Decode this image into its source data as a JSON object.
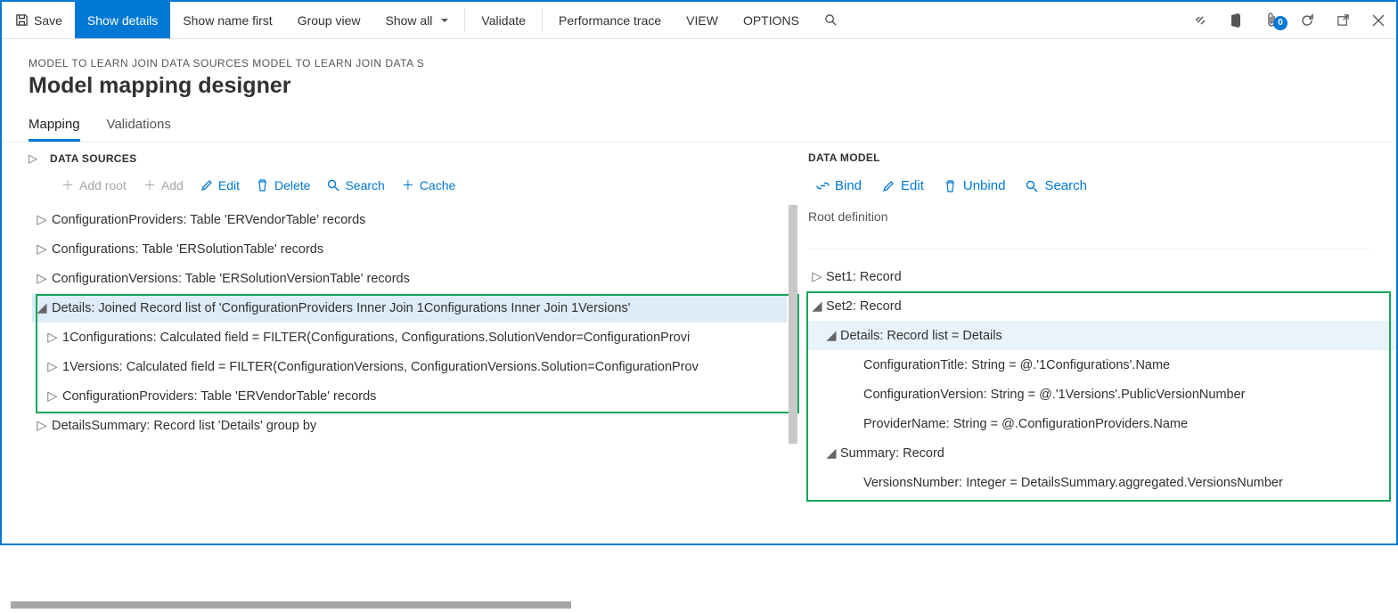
{
  "toolbar": {
    "save": "Save",
    "show_details": "Show details",
    "show_name_first": "Show name first",
    "group_view": "Group view",
    "show_all": "Show all",
    "validate": "Validate",
    "performance_trace": "Performance trace",
    "view": "VIEW",
    "options": "OPTIONS",
    "badge_count": "0"
  },
  "header": {
    "breadcrumb": "MODEL TO LEARN JOIN DATA SOURCES MODEL TO LEARN JOIN DATA S",
    "title": "Model mapping designer"
  },
  "tabs": {
    "mapping": "Mapping",
    "validations": "Validations"
  },
  "data_sources": {
    "title": "DATA SOURCES",
    "buttons": {
      "add_root": "Add root",
      "add": "Add",
      "edit": "Edit",
      "delete": "Delete",
      "search": "Search",
      "cache": "Cache"
    },
    "rows": [
      "ConfigurationProviders: Table 'ERVendorTable' records",
      "Configurations: Table 'ERSolutionTable' records",
      "ConfigurationVersions: Table 'ERSolutionVersionTable' records",
      "Details: Joined Record list of 'ConfigurationProviders Inner Join 1Configurations Inner Join 1Versions'",
      "1Configurations: Calculated field = FILTER(Configurations, Configurations.SolutionVendor=ConfigurationProvi",
      "1Versions: Calculated field = FILTER(ConfigurationVersions, ConfigurationVersions.Solution=ConfigurationProv",
      "ConfigurationProviders: Table 'ERVendorTable' records",
      "DetailsSummary: Record list 'Details' group by"
    ]
  },
  "data_model": {
    "title": "DATA MODEL",
    "buttons": {
      "bind": "Bind",
      "edit": "Edit",
      "unbind": "Unbind",
      "search": "Search"
    },
    "root_definition": "Root definition",
    "rows": [
      "Set1: Record",
      "Set2: Record",
      "Details: Record list = Details",
      "ConfigurationTitle: String = @.'1Configurations'.Name",
      "ConfigurationVersion: String = @.'1Versions'.PublicVersionNumber",
      "ProviderName: String = @.ConfigurationProviders.Name",
      "Summary: Record",
      "VersionsNumber: Integer = DetailsSummary.aggregated.VersionsNumber"
    ]
  }
}
